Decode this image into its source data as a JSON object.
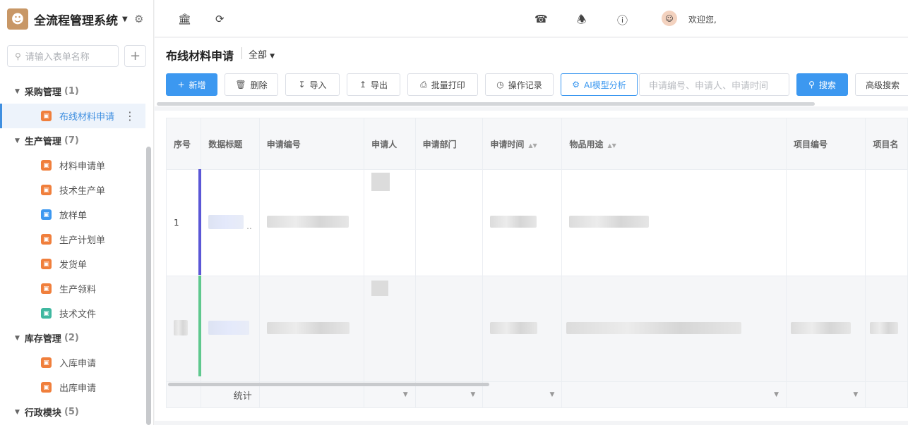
{
  "sidebar": {
    "title": "全流程管理系统",
    "search_placeholder": "请输入表单名称",
    "groups": [
      {
        "label": "采购管理",
        "count": "(1)",
        "items": [
          {
            "label": "布线材料申请",
            "color": "#f07f3c",
            "active": true
          }
        ]
      },
      {
        "label": "生产管理",
        "count": "(7)",
        "items": [
          {
            "label": "材料申请单",
            "color": "#f07f3c"
          },
          {
            "label": "技术生产单",
            "color": "#f07f3c"
          },
          {
            "label": "放样单",
            "color": "#3c98f0"
          },
          {
            "label": "生产计划单",
            "color": "#f07f3c"
          },
          {
            "label": "发货单",
            "color": "#f07f3c"
          },
          {
            "label": "生产领料",
            "color": "#f07f3c"
          },
          {
            "label": "技术文件",
            "color": "#3fb8a0"
          }
        ]
      },
      {
        "label": "库存管理",
        "count": "(2)",
        "items": [
          {
            "label": "入库申请",
            "color": "#f07f3c"
          },
          {
            "label": "出库申请",
            "color": "#f07f3c"
          }
        ]
      },
      {
        "label": "行政模块",
        "count": "(5)",
        "items": []
      }
    ]
  },
  "topbar": {
    "welcome": "欢迎您,",
    "icons": [
      "bank-icon",
      "refresh-icon",
      "headset-icon",
      "bell-icon",
      "help-icon"
    ]
  },
  "page": {
    "title": "布线材料申请",
    "filter": "全部"
  },
  "toolbar": {
    "new": "新增",
    "delete": "删除",
    "import": "导入",
    "export": "导出",
    "batch_print": "批量打印",
    "op_log": "操作记录",
    "ai": "AI模型分析",
    "search_placeholder": "申请编号、申请人、申请时间",
    "search": "搜索",
    "advanced": "高级搜索"
  },
  "table": {
    "headers": [
      "序号",
      "数据标题",
      "申请编号",
      "申请人",
      "申请部门",
      "申请时间",
      "物品用途",
      "项目编号",
      "项目名"
    ],
    "rows": [
      {
        "index": "1",
        "bar_color": "#5b57d6"
      },
      {
        "index": "",
        "bar_color": "#5fc88e"
      }
    ],
    "stat_label": "统计"
  }
}
